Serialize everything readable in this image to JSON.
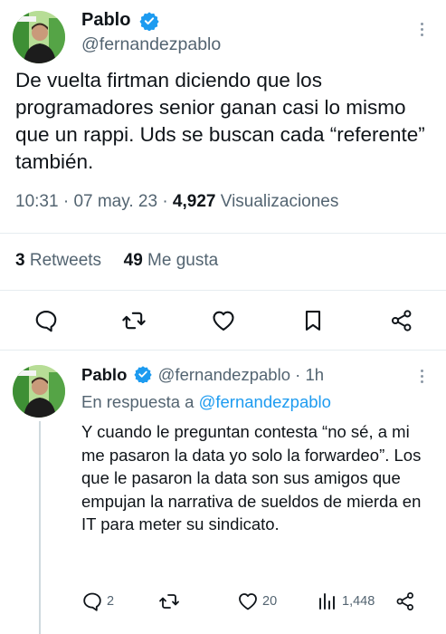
{
  "main_tweet": {
    "author_name": "Pablo",
    "handle": "@fernandezpablo",
    "text": "De vuelta firtman diciendo que los programadores senior ganan casi lo mismo que un rappi. Uds se buscan cada “referente” también.",
    "time": "10:31",
    "date": "07 may. 23",
    "views_count": "4,927",
    "views_label": "Visualizaciones",
    "retweets_count": "3",
    "retweets_label": "Retweets",
    "likes_count": "49",
    "likes_label": "Me gusta"
  },
  "reply": {
    "author_name": "Pablo",
    "handle": "@fernandezpablo",
    "age": "1h",
    "in_reply_prefix": "En respuesta a",
    "in_reply_handle": "@fernandezpablo",
    "text": "Y cuando le preguntan contesta “no sé, a mi me pasaron la data yo solo la forwardeo”. Los que le pasaron la data son sus amigos que empujan la narrativa de sueldos de mierda en IT para meter su sindicato.",
    "reply_count": "2",
    "like_count": "20",
    "view_count": "1,448"
  },
  "icons": {
    "verified": "verified-badge-icon",
    "more": "more-dots-icon",
    "reply": "speech-bubble-icon",
    "retweet": "retweet-arrows-icon",
    "like": "heart-icon",
    "bookmark": "bookmark-icon",
    "share": "share-nodes-icon",
    "views": "bar-chart-icon"
  },
  "colors": {
    "verified": "#1d9bf0",
    "link": "#1d9bf0",
    "secondary_text": "#536471"
  }
}
